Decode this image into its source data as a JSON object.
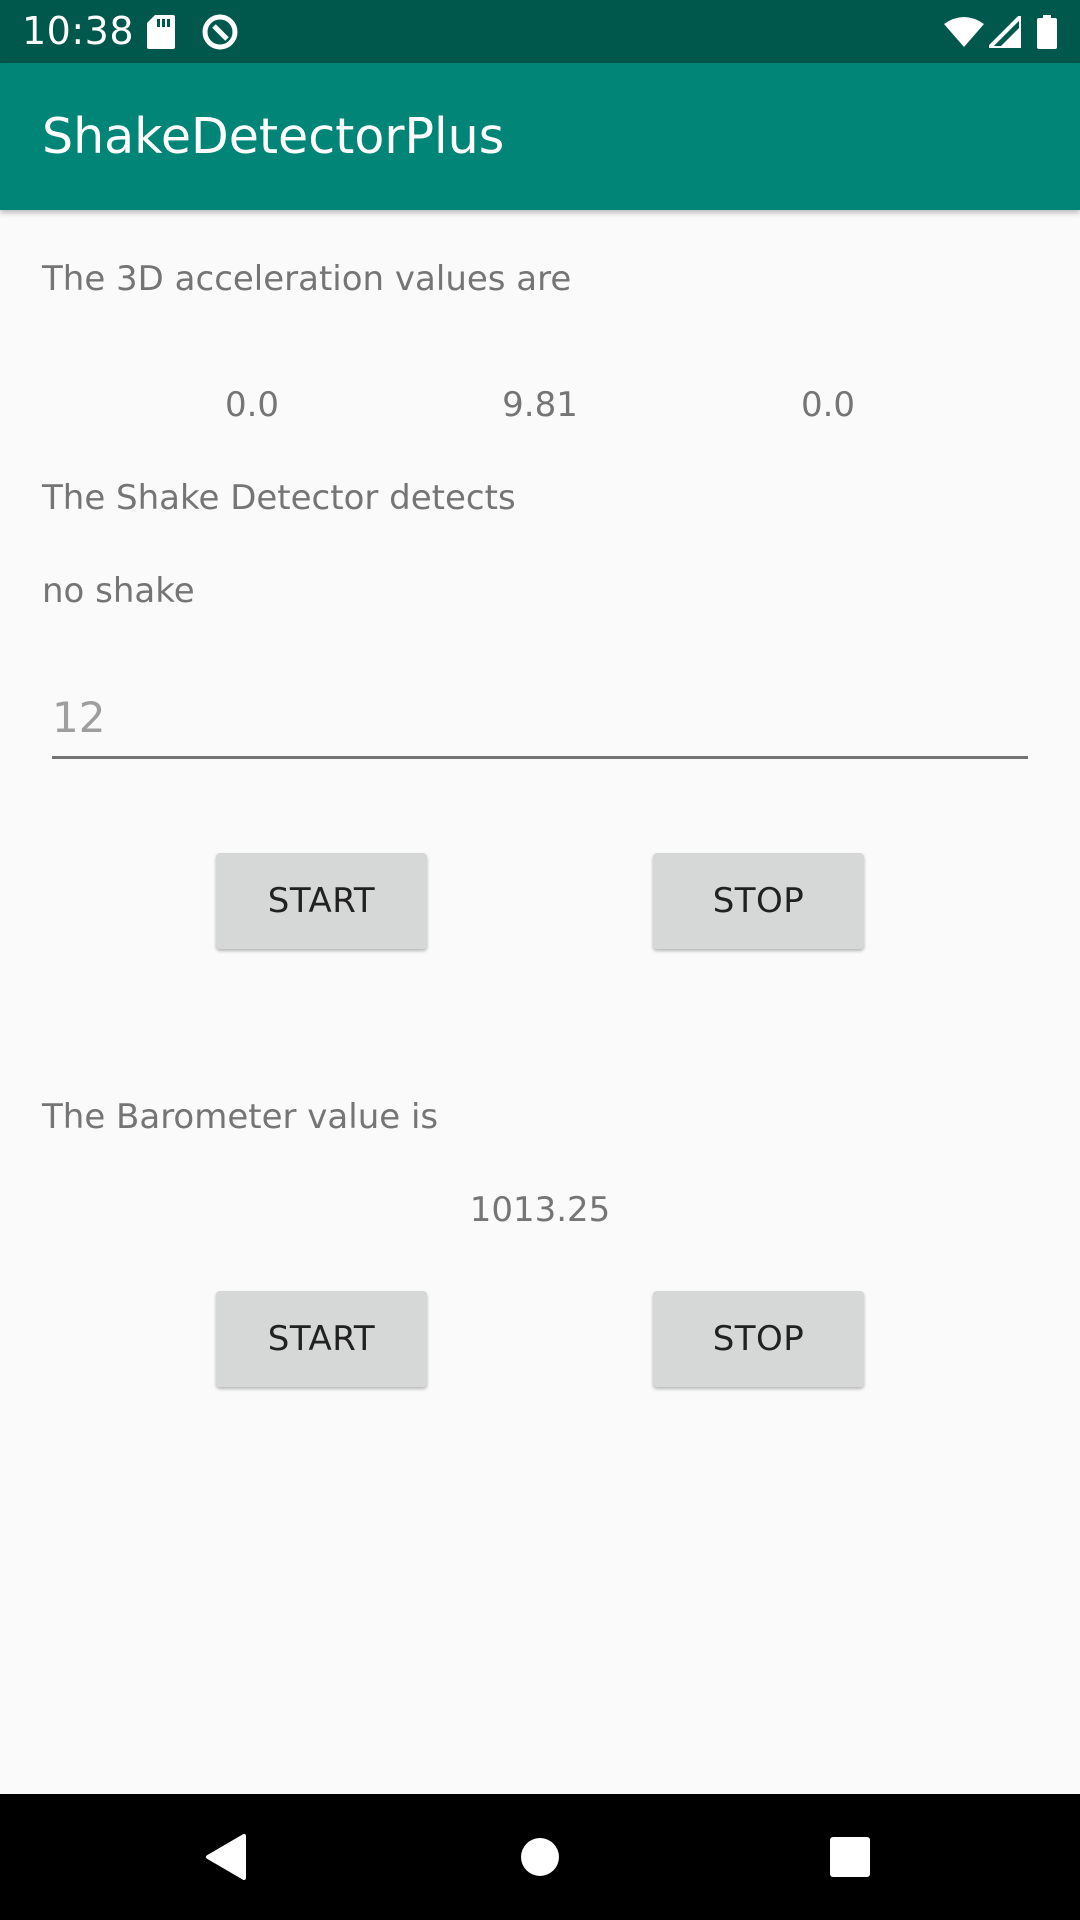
{
  "status_bar": {
    "time": "10:38",
    "background": "#00574b",
    "icons": [
      "sd-card-icon",
      "data-saver-icon",
      "wifi-icon",
      "cell-signal-icon",
      "battery-icon"
    ]
  },
  "app_bar": {
    "title": "ShakeDetectorPlus",
    "background": "#008577"
  },
  "acceleration": {
    "heading": "The 3D acceleration values are",
    "x": "0.0",
    "y": "9.81",
    "z": "0.0"
  },
  "shake": {
    "heading": "The Shake Detector detects",
    "status": "no shake",
    "threshold_placeholder": "12"
  },
  "shake_controls": {
    "start_label": "START",
    "stop_label": "STOP"
  },
  "barometer": {
    "heading": "The Barometer value is",
    "value": "1013.25"
  },
  "barometer_controls": {
    "start_label": "START",
    "stop_label": "STOP"
  },
  "nav_bar": {
    "icons": [
      "back-icon",
      "home-icon",
      "recents-icon"
    ]
  }
}
